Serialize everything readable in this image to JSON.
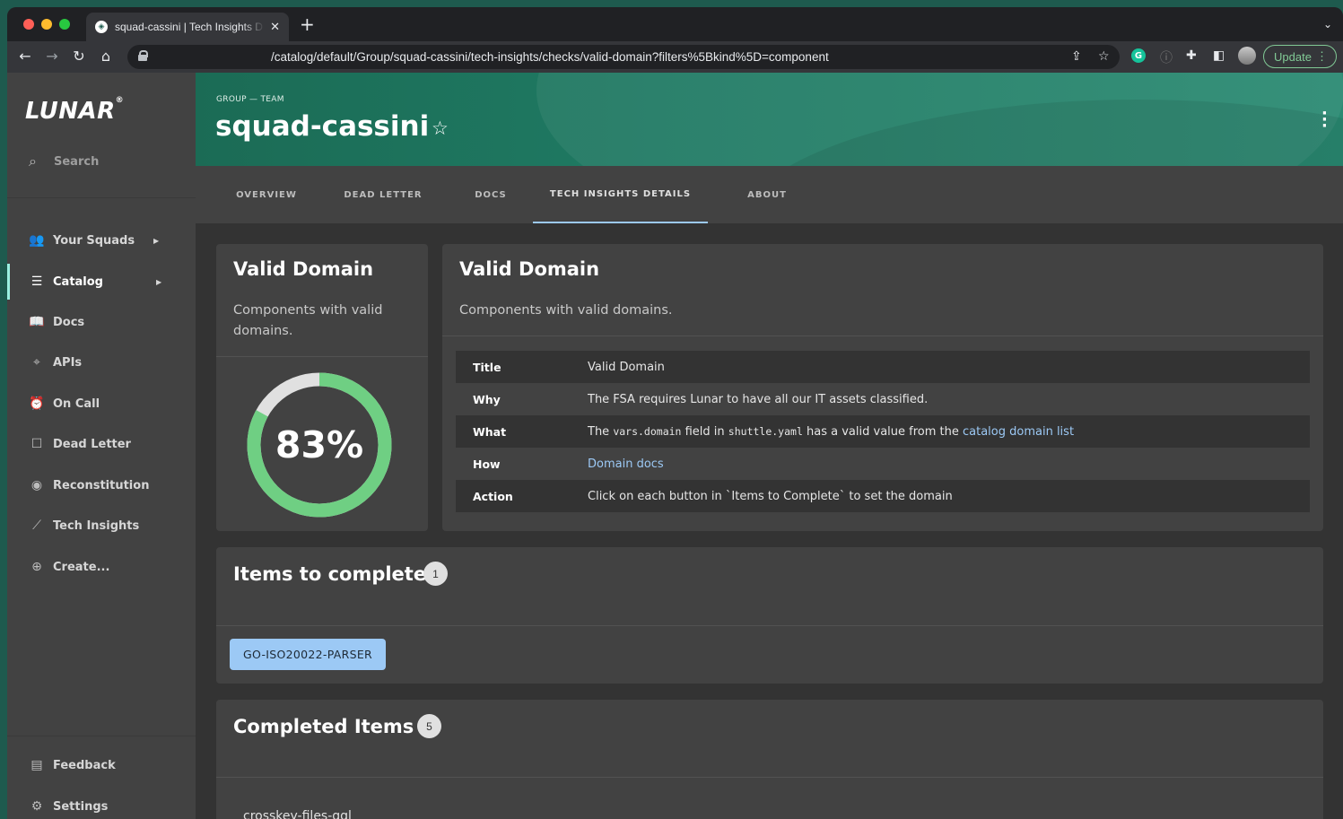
{
  "browser": {
    "tab_title": "squad-cassini | Tech Insights D",
    "tab_close": "✕",
    "new_tab": "+",
    "url": "/catalog/default/Group/squad-cassini/tech-insights/checks/valid-domain?filters%5Bkind%5D=component",
    "update_label": "Update",
    "grammarly_letter": "G"
  },
  "sidebar": {
    "logo": "LUNAR",
    "logo_mark": "®",
    "search_label": "Search",
    "items": [
      {
        "label": "Your Squads",
        "icon": "people-icon",
        "chevron": true
      },
      {
        "label": "Catalog",
        "icon": "list-icon",
        "chevron": true,
        "active": true
      },
      {
        "label": "Docs",
        "icon": "book-icon"
      },
      {
        "label": "APIs",
        "icon": "api-icon"
      },
      {
        "label": "On Call",
        "icon": "alarm-icon"
      },
      {
        "label": "Dead Letter",
        "icon": "feedback-icon"
      },
      {
        "label": "Reconstitution",
        "icon": "explore-icon"
      },
      {
        "label": "Tech Insights",
        "icon": "insights-icon"
      },
      {
        "label": "Create...",
        "icon": "add-circle-icon"
      }
    ],
    "bottom_items": [
      {
        "label": "Feedback",
        "icon": "chat-icon"
      },
      {
        "label": "Settings",
        "icon": "gear-icon"
      }
    ]
  },
  "header": {
    "breadcrumb": "GROUP — TEAM",
    "title": "squad-cassini",
    "star": "☆"
  },
  "tabs": [
    {
      "label": "OVERVIEW"
    },
    {
      "label": "DEAD LETTER"
    },
    {
      "label": "DOCS"
    },
    {
      "label": "TECH INSIGHTS DETAILS",
      "active": true
    },
    {
      "label": "ABOUT"
    }
  ],
  "summary_card": {
    "title": "Valid Domain",
    "subtitle_line1": "Components with valid",
    "subtitle_line2": "domains.",
    "percent_label": "83%",
    "percent_value": 0.83
  },
  "detail_card": {
    "title": "Valid Domain",
    "subtitle": "Components with valid domains.",
    "rows": {
      "title": {
        "key": "Title",
        "value": "Valid Domain"
      },
      "why": {
        "key": "Why",
        "value": "The FSA requires Lunar to have all our IT assets classified."
      },
      "what": {
        "key": "What",
        "pre": "The ",
        "code1": "vars.domain",
        "mid": " field in ",
        "code2": "shuttle.yaml",
        "post": " has a valid value from the ",
        "link": "catalog domain list"
      },
      "how": {
        "key": "How",
        "link": "Domain docs"
      },
      "action": {
        "key": "Action",
        "value": "Click on each button in `Items to Complete` to set the domain"
      }
    }
  },
  "items_to_complete": {
    "title": "Items to complete",
    "count": "1",
    "items": [
      "GO-ISO20022-PARSER"
    ]
  },
  "completed_items": {
    "title": "Completed Items",
    "count": "5",
    "first_item": "crosskey-files-gql"
  },
  "colors": {
    "accent_green": "#6fcf83",
    "link_blue": "#9cc9f5",
    "header_green": "#1f7a63"
  }
}
